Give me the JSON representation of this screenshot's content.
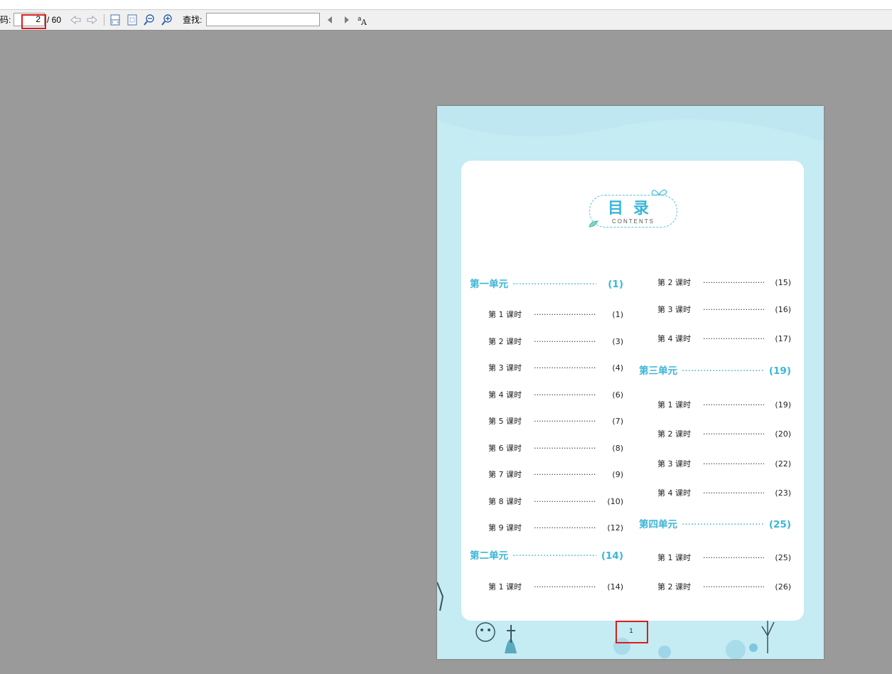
{
  "toolbar": {
    "page_label": "码:",
    "current_page": "2",
    "total_pages": "/ 60",
    "find_label": "查找:",
    "find_value": "",
    "icons": [
      "arrow-left-icon",
      "arrow-right-icon",
      "fit-width-icon",
      "fit-page-icon",
      "zoom-out-icon",
      "zoom-in-icon",
      "prev-result-icon",
      "next-result-icon",
      "font-size-icon"
    ],
    "highlight_color": "#d91e1e"
  },
  "document": {
    "title": "目录",
    "title_sub": "CONTENTS",
    "accent_color": "#3ab6d9",
    "folio": "1",
    "left_column": [
      {
        "type": "unit",
        "label": "第一单元",
        "page": "(1)"
      },
      {
        "type": "lesson",
        "label": "第 1 课时",
        "page": "(1)"
      },
      {
        "type": "lesson",
        "label": "第 2 课时",
        "page": "(3)"
      },
      {
        "type": "lesson",
        "label": "第 3 课时",
        "page": "(4)"
      },
      {
        "type": "lesson",
        "label": "第 4 课时",
        "page": "(6)"
      },
      {
        "type": "lesson",
        "label": "第 5 课时",
        "page": "(7)"
      },
      {
        "type": "lesson",
        "label": "第 6 课时",
        "page": "(8)"
      },
      {
        "type": "lesson",
        "label": "第 7 课时",
        "page": "(9)"
      },
      {
        "type": "lesson",
        "label": "第 8 课时",
        "page": "(10)"
      },
      {
        "type": "lesson",
        "label": "第 9 课时",
        "page": "(12)"
      },
      {
        "type": "unit",
        "label": "第二单元",
        "page": "(14)"
      },
      {
        "type": "lesson",
        "label": "第 1 课时",
        "page": "(14)"
      }
    ],
    "right_column": [
      {
        "type": "lesson",
        "label": "第 2 课时",
        "page": "(15)"
      },
      {
        "type": "lesson",
        "label": "第 3 课时",
        "page": "(16)"
      },
      {
        "type": "lesson",
        "label": "第 4 课时",
        "page": "(17)"
      },
      {
        "type": "unit",
        "label": "第三单元",
        "page": "(19)"
      },
      {
        "type": "lesson",
        "label": "第 1 课时",
        "page": "(19)"
      },
      {
        "type": "lesson",
        "label": "第 2 课时",
        "page": "(20)"
      },
      {
        "type": "lesson",
        "label": "第 3 课时",
        "page": "(22)"
      },
      {
        "type": "lesson",
        "label": "第 4 课时",
        "page": "(23)"
      },
      {
        "type": "unit",
        "label": "第四单元",
        "page": "(25)"
      },
      {
        "type": "lesson",
        "label": "第 1 课时",
        "page": "(25)"
      },
      {
        "type": "lesson",
        "label": "第 2 课时",
        "page": "(26)"
      }
    ]
  }
}
